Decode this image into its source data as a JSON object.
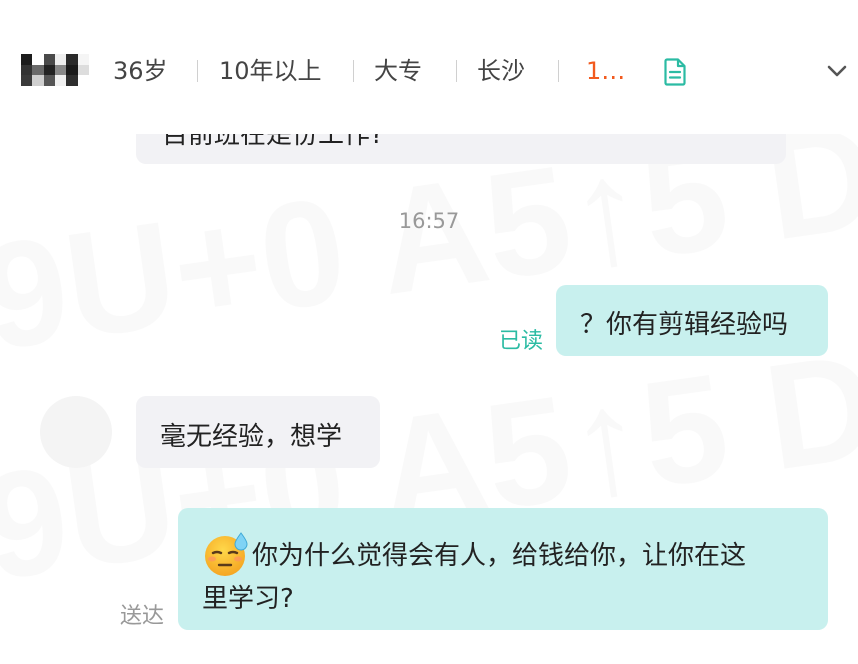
{
  "header": {
    "age": "36岁",
    "experience": "10年以上",
    "education": "大专",
    "city": "长沙",
    "salary_truncated": "1…",
    "icons": {
      "resume": "document-icon",
      "expand": "chevron-down-icon"
    }
  },
  "messages": {
    "partial_text": "目前班在是份工作?",
    "timestamp": "16:57",
    "read_status": "已读",
    "mine1": "？你有剪辑经验吗",
    "other1": "毫无经验，想学",
    "mine2_line1": "你为什么觉得会有人，给钱给你，让你在这",
    "mine2_line2": "里学习?",
    "mine2_emoji": "sweat-emoji",
    "sent_status": "送达"
  },
  "colors": {
    "accent": "#2bbba3",
    "my_bubble": "#c8f0ee",
    "their_bubble": "#f2f2f5",
    "salary": "#f25a1e"
  }
}
